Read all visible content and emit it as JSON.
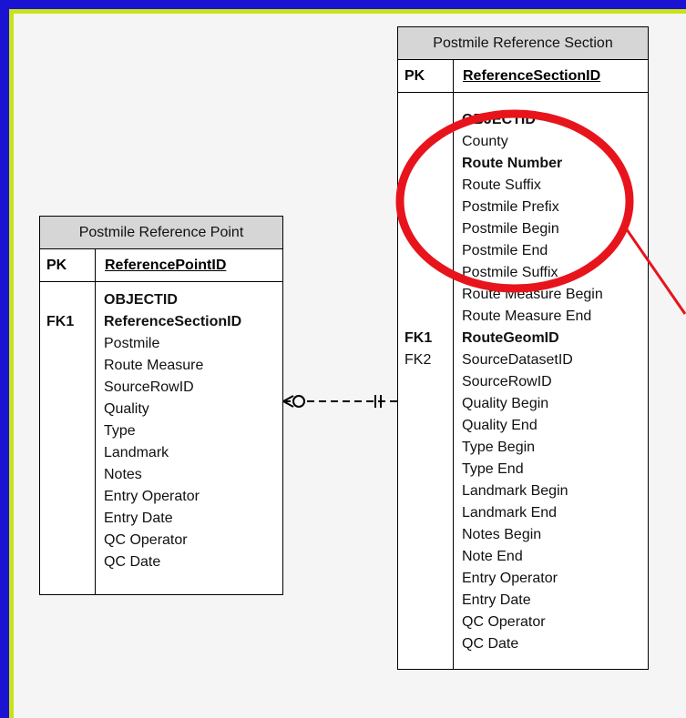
{
  "point_table": {
    "title": "Postmile Reference Point",
    "pk_label": "PK",
    "pk_name": "ReferencePointID",
    "keys": [
      "",
      "FK1"
    ],
    "attributes": [
      {
        "name": "OBJECTID",
        "bold": true
      },
      {
        "name": "ReferenceSectionID",
        "bold": true
      },
      {
        "name": "Postmile",
        "bold": false
      },
      {
        "name": "Route Measure",
        "bold": false
      },
      {
        "name": "SourceRowID",
        "bold": false
      },
      {
        "name": "Quality",
        "bold": false
      },
      {
        "name": "Type",
        "bold": false
      },
      {
        "name": "Landmark",
        "bold": false
      },
      {
        "name": "Notes",
        "bold": false
      },
      {
        "name": "Entry Operator",
        "bold": false
      },
      {
        "name": "Entry Date",
        "bold": false
      },
      {
        "name": "QC Operator",
        "bold": false
      },
      {
        "name": "QC Date",
        "bold": false
      }
    ]
  },
  "section_table": {
    "title": "Postmile Reference Section",
    "pk_label": "PK",
    "pk_name": "ReferenceSectionID",
    "keys": [
      "",
      "",
      "",
      "",
      "",
      "",
      "",
      "",
      "",
      "",
      "FK1",
      "FK2"
    ],
    "attributes": [
      {
        "name": "OBJECTID",
        "bold": true
      },
      {
        "name": "County",
        "bold": false
      },
      {
        "name": "Route Number",
        "bold": true
      },
      {
        "name": "Route Suffix",
        "bold": false
      },
      {
        "name": "Postmile Prefix",
        "bold": false
      },
      {
        "name": "Postmile Begin",
        "bold": false
      },
      {
        "name": "Postmile End",
        "bold": false
      },
      {
        "name": "Postmile Suffix",
        "bold": false
      },
      {
        "name": "Route Measure Begin",
        "bold": false
      },
      {
        "name": "Route Measure End",
        "bold": false
      },
      {
        "name": "RouteGeomID",
        "bold": true
      },
      {
        "name": "SourceDatasetID",
        "bold": false
      },
      {
        "name": "SourceRowID",
        "bold": false
      },
      {
        "name": "Quality Begin",
        "bold": false
      },
      {
        "name": "Quality End",
        "bold": false
      },
      {
        "name": "Type Begin",
        "bold": false
      },
      {
        "name": "Type End",
        "bold": false
      },
      {
        "name": "Landmark Begin",
        "bold": false
      },
      {
        "name": "Landmark End",
        "bold": false
      },
      {
        "name": "Notes Begin",
        "bold": false
      },
      {
        "name": "Note End",
        "bold": false
      },
      {
        "name": "Entry Operator",
        "bold": false
      },
      {
        "name": "Entry Date",
        "bold": false
      },
      {
        "name": "QC Operator",
        "bold": false
      },
      {
        "name": "QC Date",
        "bold": false
      }
    ]
  },
  "colors": {
    "outer_border": "#1a13d2",
    "inner_border": "#c9e21a",
    "header_fill": "#d6d6d6",
    "highlight": "#e8141c"
  }
}
